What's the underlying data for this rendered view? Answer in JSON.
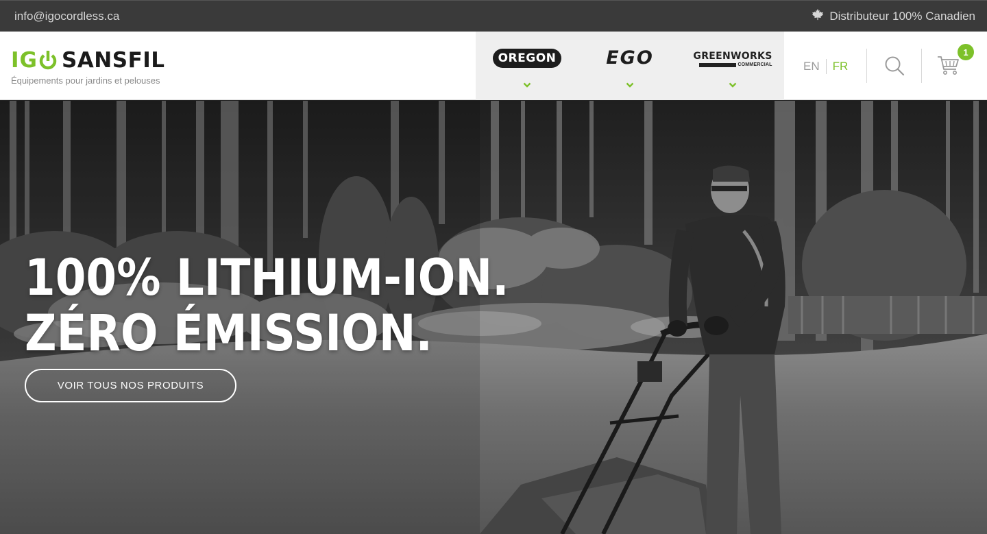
{
  "topbar": {
    "email": "info@igocordless.ca",
    "distributor": "Distributeur 100% Canadien",
    "distributor_icon": "maple-leaf-icon"
  },
  "header": {
    "logo": {
      "igo": "IG",
      "sansfil": "SANSFIL",
      "tagline": "Équipements pour jardins et pelouses"
    },
    "brands": [
      {
        "label": "OREGON"
      },
      {
        "label": "EGO"
      },
      {
        "label": "GREENWORKS",
        "sublabel": "COMMERCIAL"
      }
    ],
    "lang": {
      "en": "EN",
      "fr": "FR",
      "active": "FR"
    },
    "search_icon": "search-icon",
    "cart": {
      "icon": "cart-icon",
      "count": "1"
    }
  },
  "hero": {
    "title_line1": "100% LITHIUM-ION.",
    "title_line2": "ZÉRO ÉMISSION.",
    "cta_label": "VOIR TOUS NOS PRODUITS"
  },
  "colors": {
    "accent": "#7dc12a",
    "topbar_bg": "#3a3a3a",
    "brands_bg": "#efefef"
  }
}
